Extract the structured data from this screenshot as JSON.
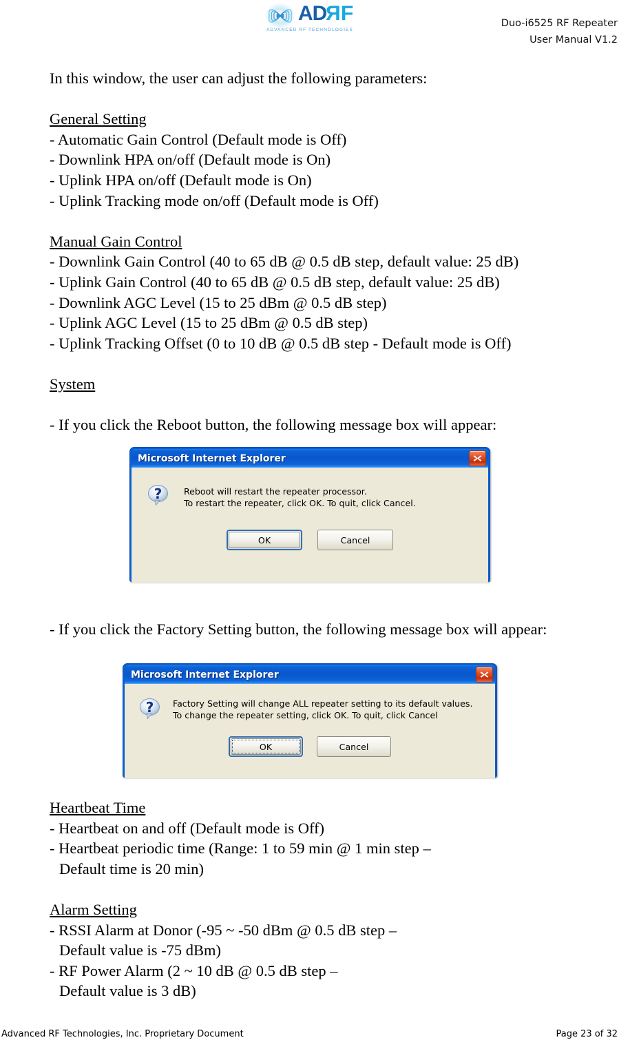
{
  "header": {
    "logo": {
      "word_ad": "AD",
      "word_r": "R",
      "word_f": "F",
      "tagline": "ADVANCED RF TECHNOLOGIES",
      "mark_icon": "adrf-butterfly-logo-icon",
      "brand_blue": "#1a5fa8",
      "brand_cyan": "#16a9df"
    },
    "title_line1": "Duo-i6525 RF Repeater",
    "title_line2": "User Manual V1.2"
  },
  "content": {
    "intro": "In this window, the user can adjust the following parameters:",
    "sections": [
      {
        "heading": "General Setting",
        "items": [
          "- Automatic Gain Control (Default mode is Off)",
          "- Downlink HPA on/off (Default mode is On)",
          "- Uplink HPA on/off (Default mode is On)",
          "- Uplink Tracking mode on/off (Default mode is Off)"
        ]
      },
      {
        "heading": "Manual Gain Control",
        "items": [
          "- Downlink Gain Control (40 to 65 dB @ 0.5 dB step, default value: 25 dB)",
          "- Uplink Gain Control (40 to 65 dB @ 0.5 dB step, default value: 25 dB)",
          "- Downlink AGC Level (15 to 25 dBm @ 0.5 dB step)",
          "- Uplink AGC Level (15 to 25 dBm @ 0.5 dB step)",
          "- Uplink Tracking Offset (0 to 10 dB @ 0.5 dB step - Default mode is Off)"
        ]
      }
    ],
    "system_heading": "System",
    "reboot_intro": "- If you click the Reboot button, the following message box will appear:",
    "factory_intro": "- If you click the Factory Setting button, the following message box will appear:",
    "heartbeat": {
      "heading": "Heartbeat Time",
      "item1": "- Heartbeat on and off (Default mode is Off)",
      "item2_line1": "- Heartbeat periodic time (Range: 1 to 59 min  @ 1 min step –",
      "item2_line2": "Default time is 20 min)"
    },
    "alarm": {
      "heading": "Alarm Setting",
      "item1_line1": "- RSSI Alarm at Donor (-95 ~ -50 dBm @ 0.5 dB step –",
      "item1_line2": "Default value is -75 dBm)",
      "item2_line1": "- RF Power Alarm (2 ~ 10 dB @ 0.5 dB step –",
      "item2_line2": "Default value is 3 dB)"
    }
  },
  "dialogs": [
    {
      "title": "Microsoft Internet Explorer",
      "close_icon": "close-icon",
      "icon": "question-bubble-icon",
      "message_line1": "Reboot will restart the repeater processor.",
      "message_line2": "To restart the repeater, click OK. To quit, click Cancel.",
      "ok_label": "OK",
      "cancel_label": "Cancel",
      "ok_focused": true,
      "ok_dotted_focus": false,
      "titlebar_color": "#0a57cc",
      "body_color": "#ece9d8",
      "close_color": "#c32f0d"
    },
    {
      "title": "Microsoft Internet Explorer",
      "close_icon": "close-icon",
      "icon": "question-bubble-icon",
      "message_line1": "Factory Setting will change ALL repeater setting to its default values.",
      "message_line2": "To change the repeater setting, click OK. To quit, click Cancel",
      "ok_label": "OK",
      "cancel_label": "Cancel",
      "ok_focused": true,
      "ok_dotted_focus": true,
      "titlebar_color": "#0a57cc",
      "body_color": "#ece9d8",
      "close_color": "#c32f0d"
    }
  ],
  "footer": {
    "left": "Advanced RF Technologies, Inc. Proprietary Document",
    "right": "Page 23 of 32"
  }
}
